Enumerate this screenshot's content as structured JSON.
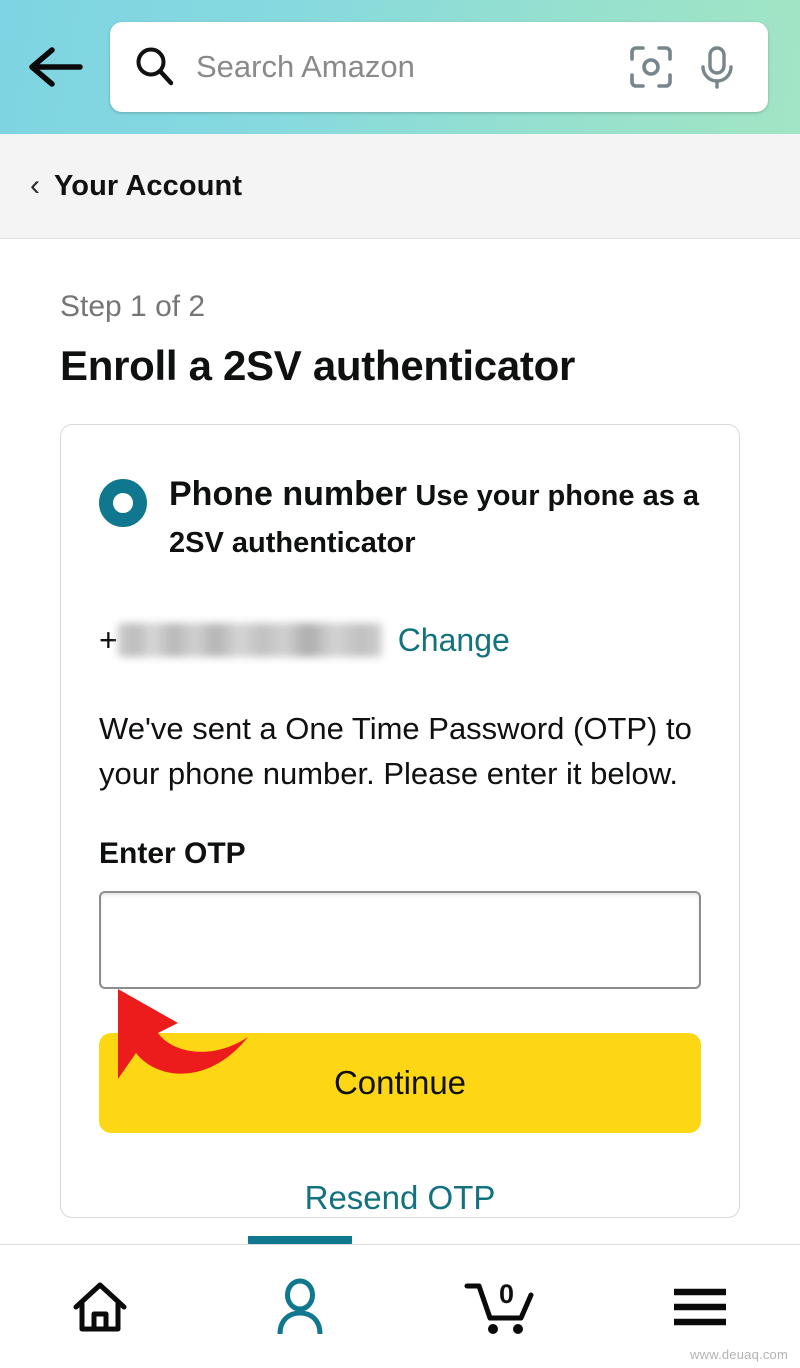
{
  "header": {
    "back_icon": "arrow-left-icon",
    "search_placeholder": "Search Amazon",
    "search_value": "",
    "search_icon": "search-icon",
    "camera_icon": "camera-scan-icon",
    "mic_icon": "microphone-icon",
    "gradient_start": "#7ed4e2",
    "gradient_end": "#a2e5c4"
  },
  "breadcrumb": {
    "chevron": "‹",
    "label": "Your Account"
  },
  "page": {
    "step": "Step 1 of 2",
    "title": "Enroll a 2SV authenticator"
  },
  "card": {
    "option": {
      "selected": true,
      "title": "Phone number",
      "description": "Use your phone as a 2SV authenticator"
    },
    "phone": {
      "prefix": "+",
      "number_masked": "",
      "change_label": "Change"
    },
    "otp_blurb": "We've sent a One Time Password (OTP) to your phone number. Please enter it below.",
    "otp_label": "Enter OTP",
    "otp_value": "",
    "otp_placeholder": "",
    "continue_label": "Continue",
    "resend_label": "Resend OTP"
  },
  "bottom_nav": {
    "items": [
      {
        "name": "home",
        "icon": "home-icon",
        "active": false
      },
      {
        "name": "account",
        "icon": "person-icon",
        "active": true
      },
      {
        "name": "cart",
        "icon": "cart-icon",
        "active": false,
        "count": "0"
      },
      {
        "name": "menu",
        "icon": "hamburger-menu-icon",
        "active": false
      }
    ]
  },
  "colors": {
    "teal": "#10788e",
    "link_teal": "#13727f",
    "yellow": "#fdd714",
    "arrow_red": "#ec1c1c"
  },
  "watermark": "www.deuaq.com"
}
